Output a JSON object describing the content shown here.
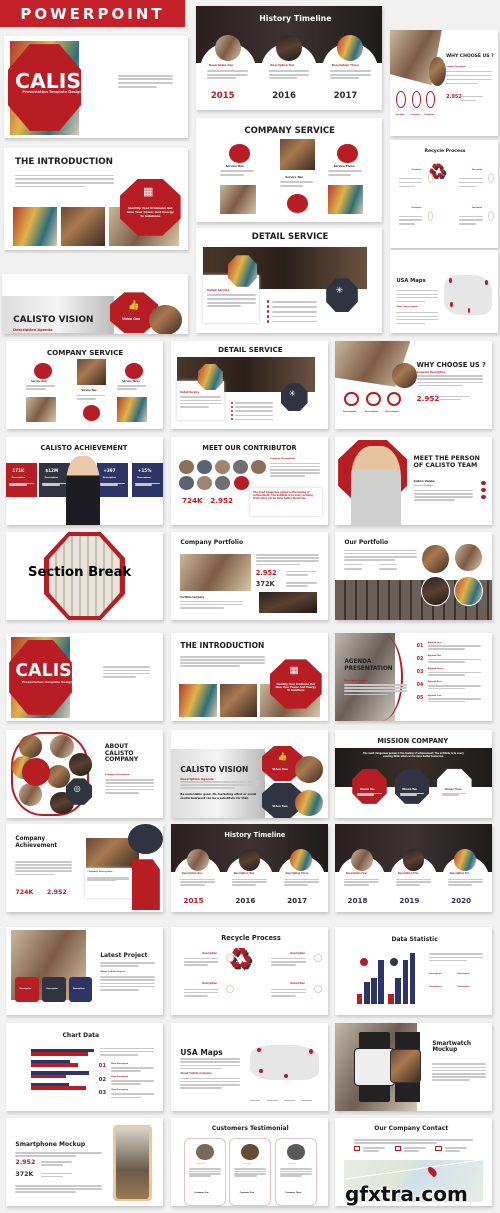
{
  "banner": "POWERPOINT",
  "watermark": "gfxtra.com",
  "colors": {
    "red": "#b81d24",
    "dark": "#2f3440",
    "navy": "#2c3566"
  },
  "slides": [
    {
      "type": "hero",
      "title": "CALISTO",
      "subtitle": "Presentation Template Design"
    },
    {
      "type": "intro",
      "title": "THE INTRODUCTION",
      "callout": "Identify Your Problems But Give Your Power And Energy To Solutions"
    },
    {
      "type": "vision",
      "title": "CALISTO VISION",
      "subtitle": "Description Agenda",
      "quote": "Be undeniable good. No marketing effort or social media buzzword can be a substitute for that.",
      "items": [
        "Video One",
        "Video Two"
      ]
    },
    {
      "type": "timeline",
      "title": "History Timeline",
      "items": [
        "Description One",
        "Description Two",
        "Description Three"
      ],
      "years": [
        "2015",
        "2016",
        "2017"
      ]
    },
    {
      "type": "service",
      "title": "COMPANY SERVICE",
      "items": [
        "Service One",
        "Service Two",
        "Service Three"
      ]
    },
    {
      "type": "detail",
      "title": "DETAIL SERVICE",
      "label": "Detail Service"
    },
    {
      "type": "why",
      "title": "WHY CHOOSE US ?",
      "subtitle": "Company Description",
      "stat": "2.952",
      "items": [
        "Description",
        "Description",
        "Description"
      ]
    },
    {
      "type": "recycle",
      "title": "Recycle Process",
      "items": [
        "Description",
        "Description",
        "Description",
        "Description"
      ]
    },
    {
      "type": "usa",
      "title": "USA Maps",
      "subtitle": "About Calisto Company"
    },
    {
      "type": "service",
      "title": "COMPANY SERVICE",
      "items": [
        "Service One",
        "Service Two",
        "Service Three"
      ]
    },
    {
      "type": "detail",
      "title": "DETAIL SERVICE",
      "label": "Detail Service"
    },
    {
      "type": "why",
      "title": "WHY CHOOSE US ?",
      "subtitle": "Company Description",
      "stat": "2.952",
      "items": [
        "Description",
        "Description",
        "Description"
      ]
    },
    {
      "type": "achievement",
      "title": "CALISTO ACHIEVEMENT",
      "stats": [
        "171K",
        "$12M",
        "+397",
        "+15%"
      ],
      "items": [
        "Description",
        "Description",
        "Description",
        "Description"
      ]
    },
    {
      "type": "contributor",
      "title": "MEET OUR CONTRIBUTOR",
      "subtitle": "Company Description",
      "stats": [
        "724K",
        "2.952"
      ],
      "quote": "The most dangerous poison is the feeling of achievement. The antidote is to every evening think what can be done better tomorrow."
    },
    {
      "type": "person",
      "title": "MEET THE PERSON OF CALISTO TEAM",
      "name": "Anton Vanke",
      "role": "General Manager"
    },
    {
      "type": "section",
      "title": "Section Break"
    },
    {
      "type": "portfolio",
      "title": "Company Portfolio",
      "stats": [
        "2.952",
        "372K"
      ],
      "label": "Portfolio Company"
    },
    {
      "type": "ourportfolio",
      "title": "Our Portfolio"
    },
    {
      "type": "hero",
      "title": "CALISTO",
      "subtitle": "Presentation Template Design"
    },
    {
      "type": "intro",
      "title": "THE INTRODUCTION",
      "callout": "Identify Your Problems But Give Your Power And Energy To Solutions"
    },
    {
      "type": "agenda",
      "title": "AGENDA PRESENTATION",
      "subtitle": "Description Agenda",
      "numbers": [
        "01",
        "02",
        "03",
        "04",
        "05"
      ],
      "items": [
        "Agenda One",
        "Agenda Two",
        "Agenda Three",
        "Agenda Four",
        "Agenda Five"
      ]
    },
    {
      "type": "about",
      "title": "ABOUT CALISTO COMPANY",
      "subtitle": "Company Description"
    },
    {
      "type": "vision",
      "title": "CALISTO VISION",
      "subtitle": "Description Agenda",
      "quote": "Be undeniable good. No marketing effort or social media buzzword can be a substitute for that.",
      "items": [
        "Video One",
        "Video Two"
      ]
    },
    {
      "type": "mission",
      "title": "MISSION COMPANY",
      "quote": "The most dangerous poison is the feeling of achievement. The antidote is to every evening think what can be done better tomorrow.",
      "items": [
        "Mission One",
        "Mission Two",
        "Mission Three"
      ]
    },
    {
      "type": "compach",
      "title": "Company Achievement",
      "stats": [
        "724K",
        "2.952"
      ],
      "label": "Company Description"
    },
    {
      "type": "timeline",
      "title": "History Timeline",
      "items": [
        "Description One",
        "Description Two",
        "Description Three"
      ],
      "years": [
        "2015",
        "2016",
        "2017"
      ]
    },
    {
      "type": "timeline",
      "title": "",
      "items": [
        "Description Four",
        "Description Five",
        "Description Six"
      ],
      "years": [
        "2018",
        "2019",
        "2020"
      ],
      "yearColor": "navy"
    },
    {
      "type": "latest",
      "title": "Latest Project",
      "subtitle": "About Calisto Project",
      "items": [
        "Description",
        "Description",
        "Description"
      ]
    },
    {
      "type": "recycle",
      "title": "Recycle Process",
      "items": [
        "Description",
        "Description",
        "Description",
        "Description"
      ]
    },
    {
      "type": "datastat",
      "title": "Data Statistic",
      "items": [
        "Description",
        "Description",
        "Description",
        "Description"
      ]
    },
    {
      "type": "chartdata",
      "title": "Chart Data",
      "numbers": [
        "01",
        "02",
        "03"
      ],
      "items": [
        "Data Description",
        "Data Description",
        "Data Description"
      ]
    },
    {
      "type": "usa",
      "title": "USA Maps",
      "subtitle": "About Calisto Company"
    },
    {
      "type": "watch",
      "title": "Smartwatch Mockup"
    },
    {
      "type": "phone",
      "title": "Smartphone Mockup",
      "stats": [
        "2.952",
        "372K"
      ]
    },
    {
      "type": "testimonial",
      "title": "Customers Testimonial",
      "items": [
        "Customer One",
        "Customer Two",
        "Customer Three"
      ],
      "stars": "★★★★★"
    },
    {
      "type": "contact",
      "title": "Our Company Contact",
      "map_label": "EAST WILLIAMSBURG"
    }
  ]
}
